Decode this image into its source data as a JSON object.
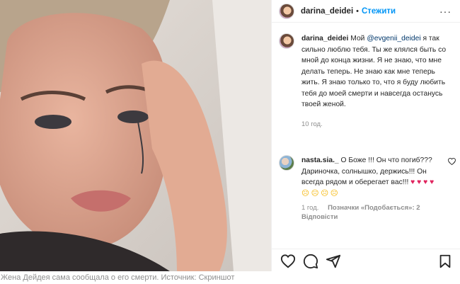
{
  "post": {
    "username": "darina_deidei",
    "follow_label": "Стежити",
    "separator": "•",
    "more_label": "···",
    "caption_user": "darina_deidei",
    "caption_before": "Мой ",
    "caption_mention": "@evgenii_deidei",
    "caption_after": " я так сильно люблю тебя. Ты же клялся быть со мной до конца жизни. Я не знаю, что мне делать теперь. Не знаю как мне теперь жить. Я знаю только то, что я буду любить тебя до моей смерти и навсегда останусь твоей женой.",
    "time": "10 год."
  },
  "comment": {
    "username": "nasta.sia._",
    "text": " О Боже !!! Он что погиб??? Дариночка, солнышко, держись!!! Он всегда рядом и оберегает вас!!! ",
    "hearts": "♥ ♥ ♥ ♥",
    "sad": "☹ ☹ ☹ ☹",
    "time": "1 год.",
    "likes": "Позначки «Подобається»: 2",
    "reply": "Відповісти",
    "like_icon": "heart-icon"
  },
  "actions": {
    "icons": [
      "heart-icon",
      "comment-icon",
      "share-icon",
      "bookmark-icon"
    ]
  },
  "photo_caption": "Жена Дейдея сама сообщала о его смерти. Источник: Скриншот"
}
